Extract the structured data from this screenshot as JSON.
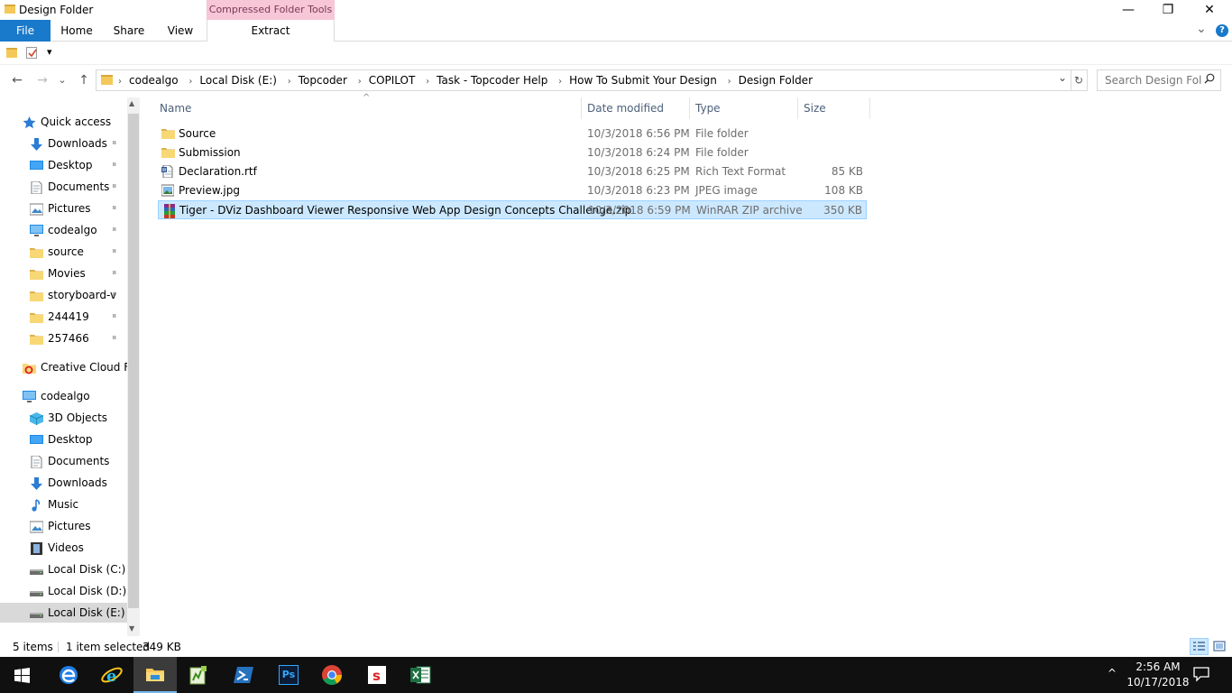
{
  "window": {
    "title": "Design Folder",
    "minimize": "—",
    "maximize": "❐",
    "close": "✕"
  },
  "ribbon": {
    "context_header": "Compressed Folder Tools",
    "tabs": [
      "File",
      "Home",
      "Share",
      "View",
      "Extract"
    ],
    "expand": "⌄",
    "help": "?"
  },
  "qat": {
    "dropdown": "▾"
  },
  "nav": {
    "back": "←",
    "forward": "→",
    "recent": "⌄",
    "up": "↑"
  },
  "address": {
    "crumbs": [
      "codealgo",
      "Local Disk (E:)",
      "Topcoder",
      "COPILOT",
      "Task - Topcoder Help",
      "How To Submit Your Design",
      "Design Folder"
    ],
    "separator": "›",
    "dropdown": "⌄",
    "refresh": "↻"
  },
  "search": {
    "placeholder": "Search Design Fol"
  },
  "sidebar": {
    "quick_access": {
      "label": "Quick access",
      "items": [
        {
          "label": "Downloads",
          "icon": "download-icon",
          "pinned": true
        },
        {
          "label": "Desktop",
          "icon": "desktop-icon",
          "pinned": true
        },
        {
          "label": "Documents",
          "icon": "documents-icon",
          "pinned": true
        },
        {
          "label": "Pictures",
          "icon": "pictures-icon",
          "pinned": true
        },
        {
          "label": "codealgo",
          "icon": "computer-icon",
          "pinned": true
        },
        {
          "label": "source",
          "icon": "folder-icon",
          "pinned": true
        },
        {
          "label": "Movies",
          "icon": "folder-icon",
          "pinned": true
        },
        {
          "label": "storyboard-v",
          "icon": "folder-icon",
          "pinned": true
        },
        {
          "label": "244419",
          "icon": "folder-icon",
          "pinned": true
        },
        {
          "label": "257466",
          "icon": "folder-icon",
          "pinned": true
        }
      ]
    },
    "creative_cloud": "Creative Cloud Fil",
    "this_pc": {
      "label": "codealgo",
      "items": [
        {
          "label": "3D Objects",
          "icon": "3d-objects-icon"
        },
        {
          "label": "Desktop",
          "icon": "desktop-icon"
        },
        {
          "label": "Documents",
          "icon": "documents-icon"
        },
        {
          "label": "Downloads",
          "icon": "download-icon"
        },
        {
          "label": "Music",
          "icon": "music-icon"
        },
        {
          "label": "Pictures",
          "icon": "pictures-icon"
        },
        {
          "label": "Videos",
          "icon": "videos-icon"
        },
        {
          "label": "Local Disk (C:)",
          "icon": "drive-icon"
        },
        {
          "label": "Local Disk (D:)",
          "icon": "drive-icon"
        },
        {
          "label": "Local Disk (E:)",
          "icon": "drive-icon",
          "selected": true
        }
      ]
    },
    "pin_glyph": "📌",
    "scroll_up": "▲",
    "scroll_down": "▼"
  },
  "columns": {
    "name": "Name",
    "date": "Date modified",
    "type": "Type",
    "size": "Size",
    "sort_indicator": "^"
  },
  "files": [
    {
      "name": "Source",
      "date": "10/3/2018 6:56 PM",
      "type": "File folder",
      "size": "",
      "icon": "folder-icon"
    },
    {
      "name": "Submission",
      "date": "10/3/2018 6:24 PM",
      "type": "File folder",
      "size": "",
      "icon": "folder-icon"
    },
    {
      "name": "Declaration.rtf",
      "date": "10/3/2018 6:25 PM",
      "type": "Rich Text Format",
      "size": "85 KB",
      "icon": "rtf-file-icon"
    },
    {
      "name": "Preview.jpg",
      "date": "10/3/2018 6:23 PM",
      "type": "JPEG image",
      "size": "108 KB",
      "icon": "image-file-icon"
    },
    {
      "name": "Tiger - DViz Dashboard Viewer Responsive Web App Design Concepts Challenge.zip",
      "date": "10/3/2018 6:59 PM",
      "type": "WinRAR ZIP archive",
      "size": "350 KB",
      "icon": "winrar-archive-icon",
      "selected": true
    }
  ],
  "status": {
    "count": "5 items",
    "selection": "1 item selected",
    "size": "349 KB"
  },
  "taskbar": {
    "apps": [
      "windows-start-icon",
      "edge-icon",
      "internet-explorer-icon",
      "file-explorer-icon",
      "notepad-plus-icon",
      "powershell-icon",
      "photoshop-icon",
      "chrome-icon",
      "sourcetree-icon",
      "excel-icon"
    ],
    "ps_label": "Ps",
    "tray_chevron": "^",
    "time": "2:56 AM",
    "date": "10/17/2018"
  },
  "colors": {
    "accent": "#1979ca",
    "selection_bg": "#cce8ff",
    "context_tab": "#f7c6d7",
    "taskbar": "#101010"
  }
}
